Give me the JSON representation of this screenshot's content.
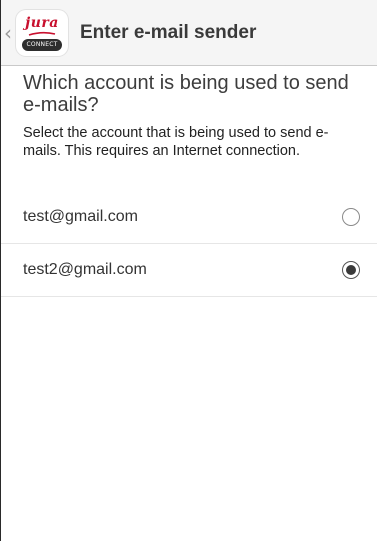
{
  "action_bar": {
    "title": "Enter e-mail sender",
    "logo": {
      "wordmark": "jura",
      "badge": "CONNECT",
      "brand_color": "#c8102e"
    },
    "back_icon": "chevron-left-icon"
  },
  "main": {
    "question": "Which account is being used to send e-mails?",
    "description": "Select the account that is being used to send e-mails. This requires an Internet connection."
  },
  "accounts": [
    {
      "email": "test@gmail.com",
      "selected": false
    },
    {
      "email": "test2@gmail.com",
      "selected": true
    }
  ]
}
